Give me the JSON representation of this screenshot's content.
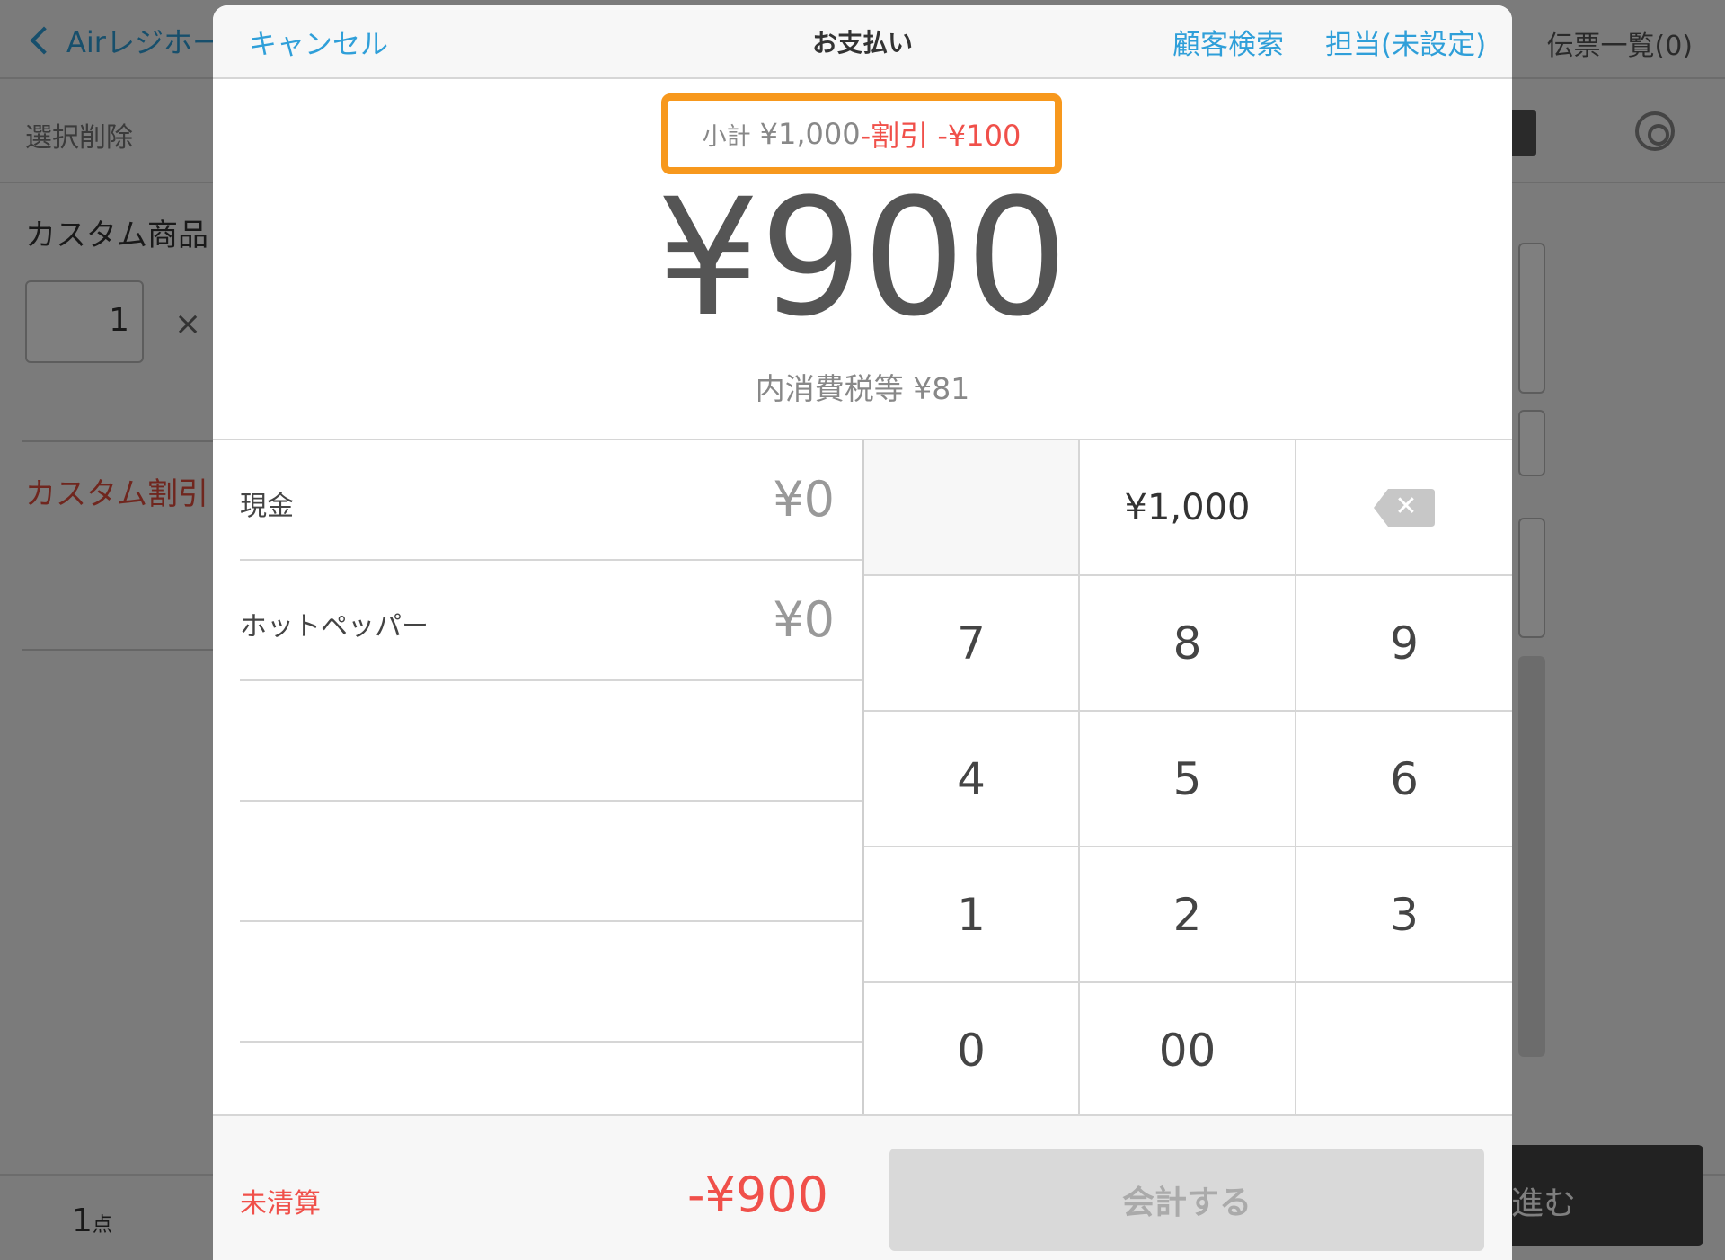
{
  "background": {
    "nav": {
      "back_label": "Airレジホー",
      "slips_label": "伝票一覧(0)"
    },
    "toolbar": {
      "delete_selected": "選択削除"
    },
    "item": {
      "name": "カスタム商品",
      "quantity": "1",
      "multiply": "×"
    },
    "discount_label": "カスタム割引",
    "footer": {
      "count": "1",
      "count_unit": "点",
      "proceed_label": "進む"
    }
  },
  "modal": {
    "header": {
      "cancel_label": "キャンセル",
      "title": "お支払い",
      "customer_search_label": "顧客検索",
      "staff_label": "担当(未設定)"
    },
    "summary": {
      "subtotal_label": "小計",
      "subtotal_value": "¥1,000",
      "discount_text": "-割引 -¥100",
      "total": "¥900",
      "tax_text": "内消費税等 ¥81",
      "highlight_color": "#f7981d"
    },
    "payments": [
      {
        "label": "現金",
        "value": "¥0"
      },
      {
        "label": "ホットペッパー",
        "value": "¥0"
      },
      {
        "label": "",
        "value": ""
      },
      {
        "label": "",
        "value": ""
      },
      {
        "label": "",
        "value": ""
      }
    ],
    "keypad": {
      "amount_key": "¥1,000",
      "backspace_icon": "backspace-icon",
      "digits": [
        "7",
        "8",
        "9",
        "4",
        "5",
        "6",
        "1",
        "2",
        "3",
        "0",
        "00"
      ]
    },
    "footer": {
      "unsettled_label": "未清算",
      "unsettled_amount": "-¥900",
      "checkout_label": "会計する"
    },
    "colors": {
      "accent": "#2f9fd9",
      "negative": "#f0504a"
    }
  }
}
